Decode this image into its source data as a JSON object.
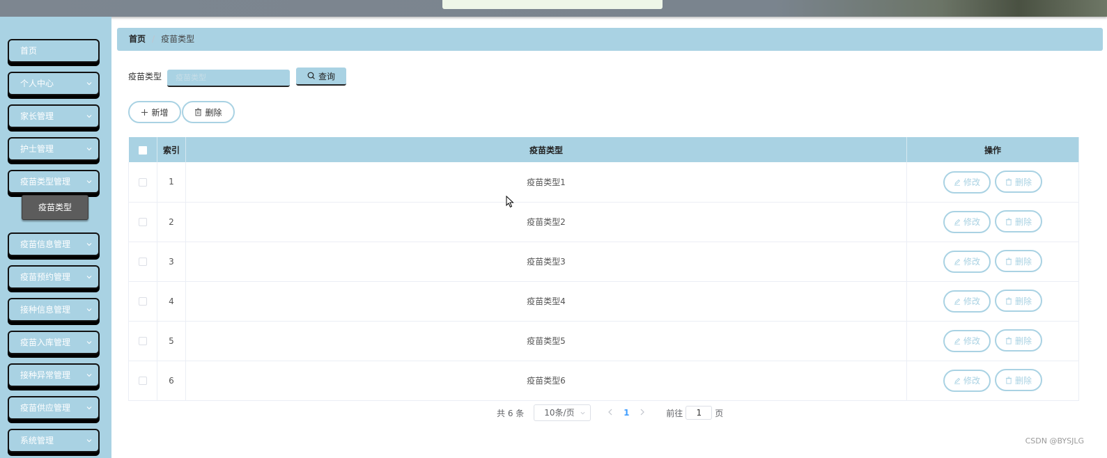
{
  "sidebar": {
    "items": [
      {
        "label": "首页",
        "has_arrow": false
      },
      {
        "label": "个人中心",
        "has_arrow": true
      },
      {
        "label": "家长管理",
        "has_arrow": true
      },
      {
        "label": "护士管理",
        "has_arrow": true
      },
      {
        "label": "疫苗类型管理",
        "has_arrow": true
      },
      {
        "label": "疫苗信息管理",
        "has_arrow": true
      },
      {
        "label": "疫苗预约管理",
        "has_arrow": true
      },
      {
        "label": "接种信息管理",
        "has_arrow": true
      },
      {
        "label": "疫苗入库管理",
        "has_arrow": true
      },
      {
        "label": "接种异常管理",
        "has_arrow": true
      },
      {
        "label": "疫苗供应管理",
        "has_arrow": true
      },
      {
        "label": "系统管理",
        "has_arrow": true
      }
    ],
    "active_sub": "疫苗类型"
  },
  "breadcrumb": {
    "home": "首页",
    "current": "疫苗类型"
  },
  "search": {
    "label": "疫苗类型",
    "placeholder": "疫苗类型",
    "value": "",
    "button": "查询"
  },
  "actions": {
    "add": "新增",
    "delete": "删除"
  },
  "table": {
    "headers": {
      "index": "索引",
      "type": "疫苗类型",
      "ops": "操作"
    },
    "rows": [
      {
        "index": "1",
        "type": "疫苗类型1"
      },
      {
        "index": "2",
        "type": "疫苗类型2"
      },
      {
        "index": "3",
        "type": "疫苗类型3"
      },
      {
        "index": "4",
        "type": "疫苗类型4"
      },
      {
        "index": "5",
        "type": "疫苗类型5"
      },
      {
        "index": "6",
        "type": "疫苗类型6"
      }
    ],
    "row_actions": {
      "edit": "修改",
      "delete": "删除"
    }
  },
  "pagination": {
    "total": "共 6 条",
    "page_size": "10条/页",
    "current_page": "1",
    "goto_label": "前往",
    "goto_value": "1",
    "goto_suffix": "页"
  },
  "watermark": "CSDN @BYSJLG",
  "colors": {
    "accent": "#a9d2e3",
    "active_sub": "#5c5c5c",
    "page_active": "#409eff"
  }
}
